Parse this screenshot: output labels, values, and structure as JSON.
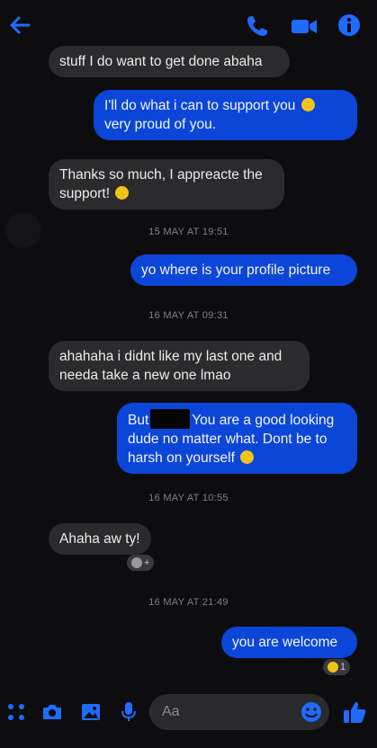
{
  "messages": [
    {
      "dir": "in",
      "text": "stuff I do want to get done abaha"
    },
    {
      "dir": "out",
      "line1": "I'll do what i can to support you",
      "line2": "very proud of you."
    },
    {
      "dir": "in",
      "line1": "Thanks so much, I appreacte the",
      "line2": "support!"
    },
    {
      "dir": "out",
      "text": "yo where is your profile picture"
    },
    {
      "dir": "in",
      "line1": "ahahaha i didnt like my last one and",
      "line2": "needa take a new one lmao"
    },
    {
      "dir": "out",
      "pre": "But",
      "post": "You are a good looking",
      "line2": "dude no matter what. Dont be to",
      "line3": "harsh on yourself"
    },
    {
      "dir": "in",
      "text": "Ahaha aw ty!"
    },
    {
      "dir": "out",
      "text": "you are welcome"
    }
  ],
  "timestamps": [
    "15 MAY AT 19:51",
    "16 MAY AT 09:31",
    "16 MAY AT 10:55",
    "16 MAY AT 21:49"
  ],
  "reactions": {
    "add_label": "+",
    "love_count": "1"
  },
  "composer": {
    "placeholder": "Aa"
  },
  "colors": {
    "accent": "#1f6bff",
    "outgoing_bubble": "#0c46d8",
    "incoming_bubble": "#2b2b2e",
    "background": "#0d0d0f"
  },
  "icons": [
    "back-arrow-icon",
    "phone-icon",
    "video-camera-icon",
    "info-icon",
    "apps-grid-icon",
    "camera-icon",
    "gallery-icon",
    "microphone-icon",
    "emoji-icon",
    "thumbs-up-icon"
  ]
}
